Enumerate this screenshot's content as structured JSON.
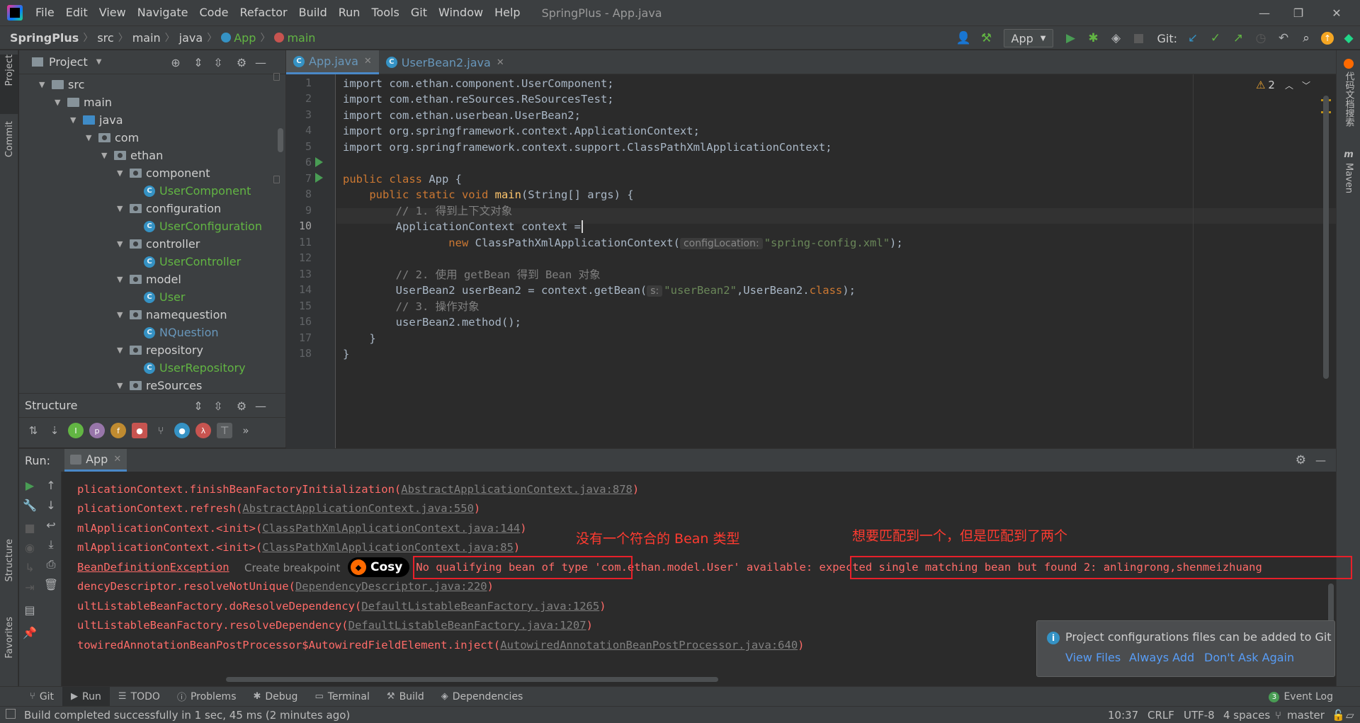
{
  "window": {
    "title": "SpringPlus - App.java",
    "menu": [
      "File",
      "Edit",
      "View",
      "Navigate",
      "Code",
      "Refactor",
      "Build",
      "Run",
      "Tools",
      "Git",
      "Window",
      "Help"
    ],
    "minimize": "—",
    "maximize": "❐",
    "close": "✕"
  },
  "breadcrumb": {
    "project": "SpringPlus",
    "items": [
      "src",
      "main",
      "java",
      "App",
      "main"
    ],
    "sep": "〉"
  },
  "toolbar": {
    "run_config": "App",
    "git_label": "Git:"
  },
  "left_stripe": {
    "project_tab": "Project",
    "commit_tab": "Commit",
    "structure_tab": "Structure",
    "favorites_tab": "Favorites"
  },
  "right_stripe": {
    "docs_tab": "代码文档搜索",
    "maven_tab": "Maven"
  },
  "project_panel": {
    "title": "Project",
    "tree": [
      {
        "label": "src",
        "type": "folder"
      },
      {
        "label": "main",
        "type": "folder"
      },
      {
        "label": "java",
        "type": "src"
      },
      {
        "label": "com",
        "type": "pkg"
      },
      {
        "label": "ethan",
        "type": "pkg"
      },
      {
        "label": "component",
        "type": "pkg"
      },
      {
        "label": "UserComponent",
        "type": "class"
      },
      {
        "label": "configuration",
        "type": "pkg"
      },
      {
        "label": "UserConfiguration",
        "type": "class"
      },
      {
        "label": "controller",
        "type": "pkg"
      },
      {
        "label": "UserController",
        "type": "class"
      },
      {
        "label": "model",
        "type": "pkg"
      },
      {
        "label": "User",
        "type": "class"
      },
      {
        "label": "namequestion",
        "type": "pkg"
      },
      {
        "label": "NQuestion",
        "type": "class"
      },
      {
        "label": "repository",
        "type": "pkg"
      },
      {
        "label": "UserRepository",
        "type": "class"
      },
      {
        "label": "reSources",
        "type": "pkg"
      }
    ]
  },
  "structure_panel": {
    "title": "Structure",
    "more": "»"
  },
  "editor": {
    "tabs": [
      {
        "label": "App.java",
        "active": true
      },
      {
        "label": "UserBean2.java",
        "active": false
      }
    ],
    "warning_count": "2",
    "lines": [
      {
        "n": "1"
      },
      {
        "n": "2"
      },
      {
        "n": "3"
      },
      {
        "n": "4"
      },
      {
        "n": "5"
      },
      {
        "n": "6"
      },
      {
        "n": "7"
      },
      {
        "n": "8"
      },
      {
        "n": "9"
      },
      {
        "n": "10"
      },
      {
        "n": "11"
      },
      {
        "n": "12"
      },
      {
        "n": "13"
      },
      {
        "n": "14"
      },
      {
        "n": "15"
      },
      {
        "n": "16"
      },
      {
        "n": "17"
      },
      {
        "n": "18"
      }
    ],
    "code": {
      "l1": "import com.ethan.component.UserComponent;",
      "l2": "import com.ethan.reSources.ReSourcesTest;",
      "l3": "import com.ethan.userbean.UserBean2;",
      "l4": "import org.springframework.context.ApplicationContext;",
      "l5": "import org.springframework.context.support.ClassPathXmlApplicationContext;",
      "l7_kw": "public class ",
      "l7_rest": "App {",
      "l8_kw": "    public static void ",
      "l8_fn": "main",
      "l8_rest": "(String[] args) {",
      "l9": "        // 1. 得到上下文对象",
      "l10": "        ApplicationContext context =",
      "l11_kw": "                new ",
      "l11_rest": "ClassPathXmlApplicationContext(",
      "l11_hint": "configLocation:",
      "l11_str": "\"spring-config.xml\"",
      "l11_end": ");",
      "l13": "        // 2. 使用 getBean 得到 Bean 对象",
      "l14_a": "        UserBean2 userBean2 = context.getBean(",
      "l14_hint": "s:",
      "l14_str": "\"userBean2\"",
      "l14_b": ",UserBean2.",
      "l14_kw": "class",
      "l14_c": ");",
      "l15": "        // 3. 操作对象",
      "l16": "        userBean2.method();",
      "l17": "    }",
      "l18": "}"
    }
  },
  "run_panel": {
    "label": "Run:",
    "tab": "App",
    "console": {
      "c1_a": "plicationContext.finishBeanFactoryInitialization(",
      "c1_link": "AbstractApplicationContext.java:878",
      "c2_a": "plicationContext.refresh(",
      "c2_link": "AbstractApplicationContext.java:550",
      "c3_a": "mlApplicationContext.<init>(",
      "c3_link": "ClassPathXmlApplicationContext.java:144",
      "c4_a": "mlApplicationContext.<init>(",
      "c4_link": "ClassPathXmlApplicationContext.java:85",
      "c5_a": "BeanDefinitionException",
      "c5_b": ": No qualifying bean of type 'com.ethan.model.User' available: expected single matching bean but found 2: anlingrong,shenmeizhuang",
      "c6_a": "dencyDescriptor.resolveNotUnique(",
      "c6_link": "DependencyDescriptor.java:220",
      "c7_a": "ultListableBeanFactory.doResolveDependency(",
      "c7_link": "DefaultListableBeanFactory.java:1265",
      "c8_a": "ultListableBeanFactory.resolveDependency(",
      "c8_link": "DefaultListableBeanFactory.java:1207",
      "c9_a": "towiredAnnotationBeanPostProcessor$AutowiredFieldElement.inject(",
      "c9_link": "AutowiredAnnotationBeanPostProcessor.java:640",
      "close_paren": ")"
    },
    "create_breakpoint": "Create breakpoint",
    "cosy": "Cosy",
    "annotation_left": "没有一个符合的 Bean 类型",
    "annotation_right": "想要匹配到一个，但是匹配到了两个"
  },
  "notification": {
    "message": "Project configurations files can be added to Git",
    "view_files": "View Files",
    "always_add": "Always Add",
    "dont_ask": "Don't Ask Again"
  },
  "bottom_tools": {
    "git": "Git",
    "run": "Run",
    "todo": "TODO",
    "problems": "Problems",
    "debug": "Debug",
    "terminal": "Terminal",
    "build": "Build",
    "dependencies": "Dependencies",
    "event_log": "Event Log",
    "event_count": "3"
  },
  "status_bar": {
    "message": "Build completed successfully in 1 sec, 45 ms (2 minutes ago)",
    "position": "10:37",
    "line_sep": "CRLF",
    "encoding": "UTF-8",
    "indent": "4 spaces",
    "branch": "master"
  },
  "colors": {
    "background": "#2b2b2b",
    "panel": "#3c3f41",
    "keyword": "#cc7832",
    "string": "#6a8759",
    "error": "#ff6b68",
    "annotation": "#ff3b30",
    "link": "#589df6"
  }
}
